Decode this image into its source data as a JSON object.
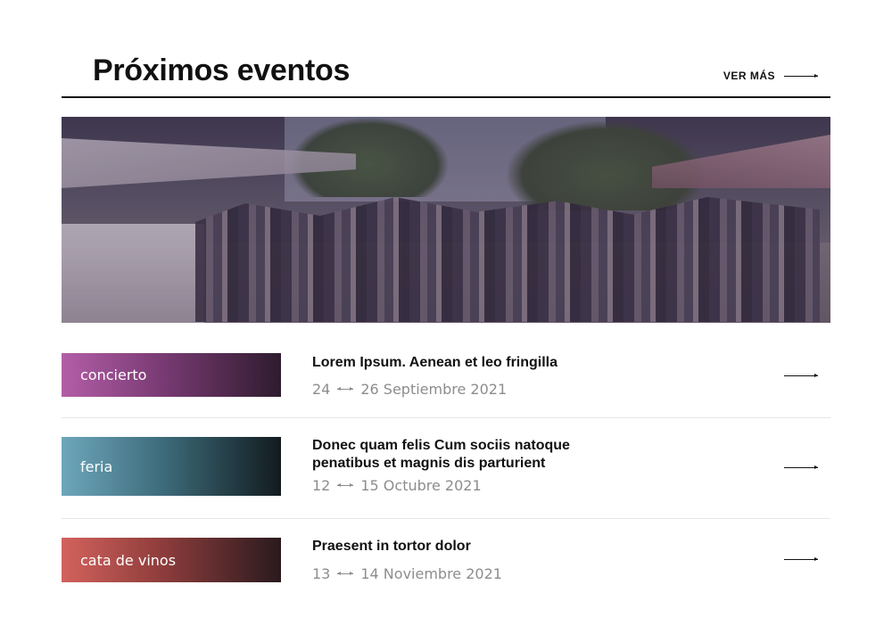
{
  "header": {
    "title": "Próximos eventos",
    "see_more_label": "VER MÁS",
    "see_more_icon": "arrow-right-icon"
  },
  "hero": {
    "image_alt": "market-street-photo"
  },
  "events": [
    {
      "category": "concierto",
      "title": "Lorem Ipsum. Aenean et leo fringilla",
      "date_start": "24",
      "date_end": "26 Septiembre 2021",
      "category_color": "#b35ea7"
    },
    {
      "category": "feria",
      "title": "Donec quam felis Cum sociis natoque penatibus et magnis dis parturient",
      "date_start": "12",
      "date_end": "15 Octubre 2021",
      "category_color": "#6ea6bb"
    },
    {
      "category": "cata de vinos",
      "title": "Praesent in tortor dolor",
      "date_start": "13",
      "date_end": "14 Noviembre 2021",
      "category_color": "#d3625d"
    }
  ]
}
